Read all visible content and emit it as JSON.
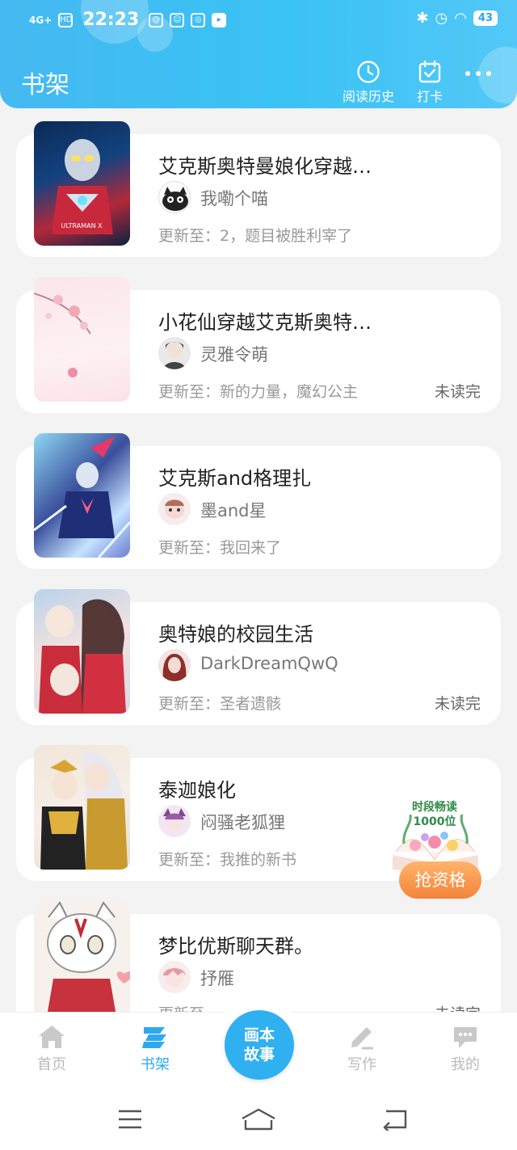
{
  "status_bar": {
    "time": "22:23",
    "network": "4G+",
    "hd": "HD",
    "battery": "43"
  },
  "header": {
    "title": "书架",
    "history_label": "阅读历史",
    "checkin_label": "打卡"
  },
  "books": [
    {
      "title": "艾克斯奥特曼娘化穿越…",
      "author": "我嘞个喵",
      "update": "更新至：2，题目被胜利宰了",
      "unread": ""
    },
    {
      "title": "小花仙穿越艾克斯奥特…",
      "author": "灵雅令萌",
      "update": "更新至：新的力量，魔幻公主",
      "unread": "未读完"
    },
    {
      "title": "艾克斯and格理扎",
      "author": "墨and星",
      "update": "更新至：我回来了",
      "unread": ""
    },
    {
      "title": "奥特娘的校园生活",
      "author": "DarkDreamQwQ",
      "update": "更新至：圣者遗骸",
      "unread": "未读完"
    },
    {
      "title": "泰迦娘化",
      "author": "闷骚老狐狸",
      "update": "更新至：我推的新书",
      "unread": ""
    },
    {
      "title": "梦比优斯聊天群。",
      "author": "抒雁",
      "update": "更新至",
      "unread": "未读完"
    }
  ],
  "cover_text": {
    "book1": "ULTRAMAN X"
  },
  "promo": {
    "line1": "时段畅读",
    "line2": "1000位",
    "button": "抢资格"
  },
  "bottom_nav": {
    "home": "首页",
    "shelf": "书架",
    "center_line1": "画本",
    "center_line2": "故事",
    "write": "写作",
    "mine": "我的"
  },
  "colors": {
    "accent": "#2ea9ef",
    "header_start": "#45b9f1",
    "header_end": "#53c8f7",
    "promo_orange": "#f2843a"
  }
}
